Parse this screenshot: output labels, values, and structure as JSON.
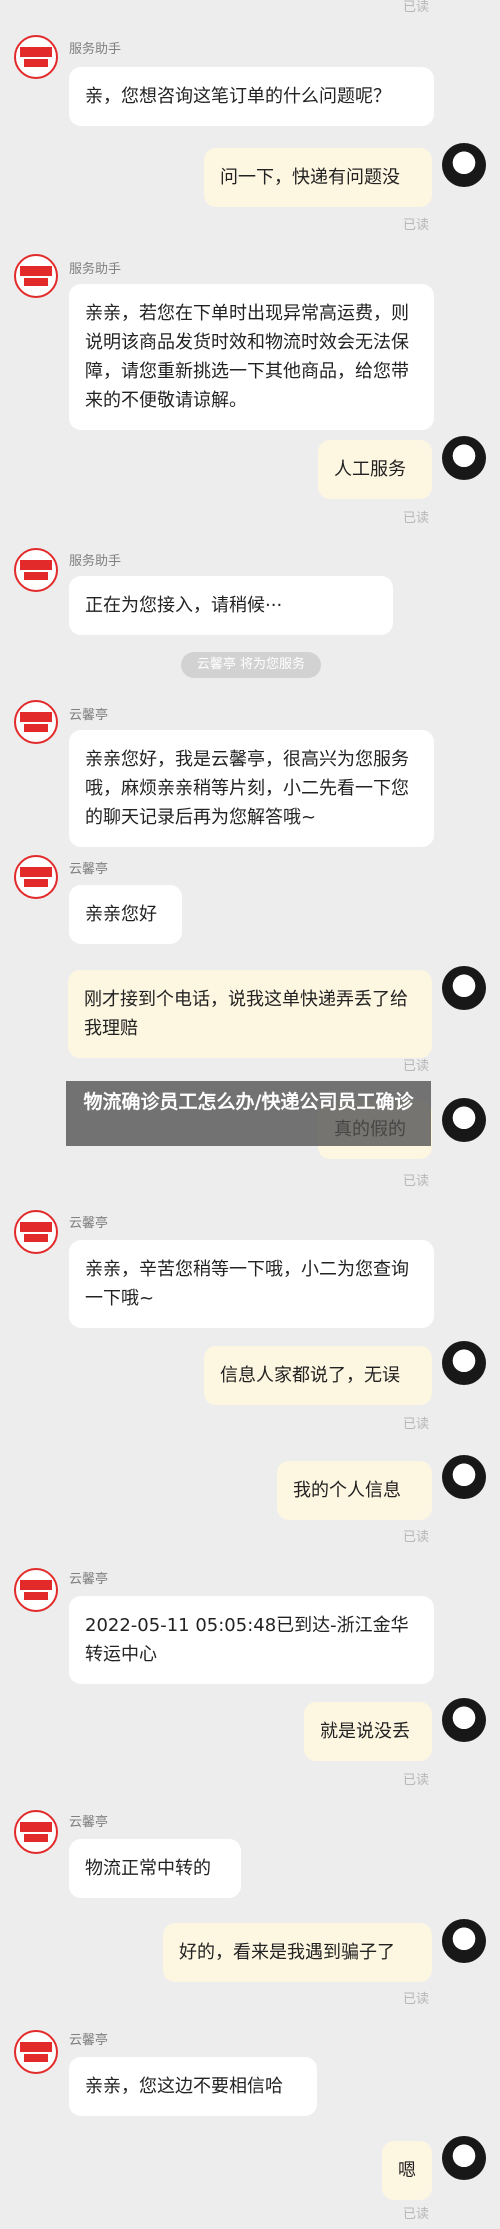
{
  "status": {
    "read_label": "已读"
  },
  "senders": {
    "service": "服务助手",
    "agent": "云馨亭"
  },
  "system": {
    "notice": "云馨亭 将为您服务"
  },
  "overlay": {
    "title": "物流确诊员工怎么办/快递公司员工确诊"
  },
  "messages": [
    {
      "side": "left",
      "sender": "服务助手",
      "text": "亲，您想咨询这笔订单的什么问题呢？"
    },
    {
      "side": "right",
      "text": "问一下，快递有问题没"
    },
    {
      "side": "left",
      "sender": "服务助手",
      "text": "亲亲，若您在下单时出现异常高运费，则说明该商品发货时效和物流时效会无法保障，请您重新挑选一下其他商品，给您带来的不便敬请谅解。"
    },
    {
      "side": "right",
      "text": "人工服务"
    },
    {
      "side": "left",
      "sender": "服务助手",
      "text": "正在为您接入，请稍候···"
    },
    {
      "side": "left",
      "sender": "云馨亭",
      "text": "亲亲您好，我是云馨亭，很高兴为您服务哦，麻烦亲亲稍等片刻，小二先看一下您的聊天记录后再为您解答哦~"
    },
    {
      "side": "left",
      "sender": "云馨亭",
      "text": "亲亲您好"
    },
    {
      "side": "right",
      "text": "刚才接到个电话，说我这单快递弄丢了给我理赔"
    },
    {
      "side": "right",
      "text": "真的假的"
    },
    {
      "side": "left",
      "sender": "云馨亭",
      "text": "亲亲，辛苦您稍等一下哦，小二为您查询一下哦~"
    },
    {
      "side": "right",
      "text": "信息人家都说了，无误"
    },
    {
      "side": "right",
      "text": "我的个人信息"
    },
    {
      "side": "left",
      "sender": "云馨亭",
      "text": "2022-05-11 05:05:48已到达-浙江金华转运中心"
    },
    {
      "side": "right",
      "text": "就是说没丢"
    },
    {
      "side": "left",
      "sender": "云馨亭",
      "text": "物流正常中转的"
    },
    {
      "side": "right",
      "text": "好的，看来是我遇到骗子了"
    },
    {
      "side": "left",
      "sender": "云馨亭",
      "text": "亲亲，您这边不要相信哈"
    },
    {
      "side": "right",
      "text": "嗯"
    }
  ],
  "colors": {
    "background": "#ededed",
    "right_bubble": "#fdf6e1",
    "shop_avatar_red": "#e22a2a"
  }
}
